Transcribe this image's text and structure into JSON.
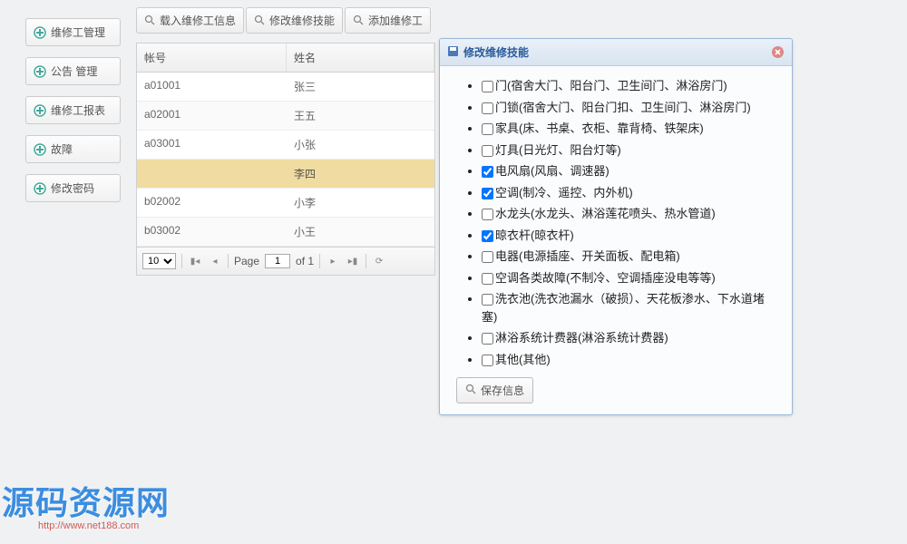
{
  "sidebar": {
    "items": [
      {
        "label": "维修工管理"
      },
      {
        "label": "公告 管理"
      },
      {
        "label": "维修工报表"
      },
      {
        "label": "故障"
      },
      {
        "label": "修改密码"
      }
    ]
  },
  "tabs": [
    {
      "label": "载入维修工信息"
    },
    {
      "label": "修改维修技能"
    },
    {
      "label": "添加维修工"
    }
  ],
  "grid": {
    "headers": {
      "account": "帐号",
      "name": "姓名"
    },
    "rows": [
      {
        "account": "a01001",
        "name": "张三",
        "selected": false
      },
      {
        "account": "a02001",
        "name": "王五",
        "selected": false
      },
      {
        "account": "a03001",
        "name": "小张",
        "selected": false
      },
      {
        "account": "",
        "name": "李四",
        "selected": true
      },
      {
        "account": "b02002",
        "name": "小李",
        "selected": false
      },
      {
        "account": "b03002",
        "name": "小王",
        "selected": false
      }
    ]
  },
  "pager": {
    "pageSize": "10",
    "pageLabel": "Page",
    "pageValue": "1",
    "ofLabel": "of 1"
  },
  "dialog": {
    "title": "修改维修技能",
    "saveLabel": "保存信息",
    "skills": [
      {
        "checked": false,
        "label": "门(宿舍大门、阳台门、卫生间门、淋浴房门)"
      },
      {
        "checked": false,
        "label": "门锁(宿舍大门、阳台门扣、卫生间门、淋浴房门)"
      },
      {
        "checked": false,
        "label": "家具(床、书桌、衣柜、靠背椅、铁架床)"
      },
      {
        "checked": false,
        "label": "灯具(日光灯、阳台灯等)"
      },
      {
        "checked": true,
        "label": "电风扇(风扇、调速器)"
      },
      {
        "checked": true,
        "label": "空调(制冷、遥控、内外机)"
      },
      {
        "checked": false,
        "label": "水龙头(水龙头、淋浴莲花喷头、热水管道)"
      },
      {
        "checked": true,
        "label": "晾衣杆(晾衣杆)"
      },
      {
        "checked": false,
        "label": "电器(电源插座、开关面板、配电箱)"
      },
      {
        "checked": false,
        "label": "空调各类故障(不制冷、空调插座没电等等)"
      },
      {
        "checked": false,
        "label": "洗衣池(洗衣池漏水（破损）、天花板渗水、下水道堵塞)"
      },
      {
        "checked": false,
        "label": "淋浴系统计费器(淋浴系统计费器)"
      },
      {
        "checked": false,
        "label": "其他(其他)"
      }
    ]
  },
  "watermark": {
    "text": "源码资源网",
    "url": "http://www.net188.com"
  }
}
